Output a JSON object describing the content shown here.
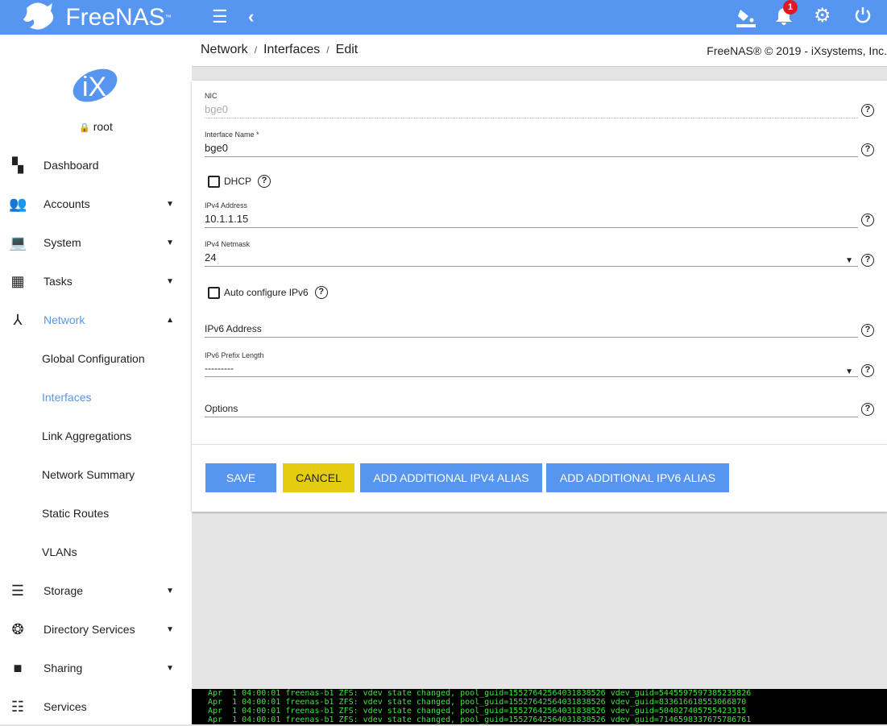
{
  "brand": {
    "name": "FreeNAS",
    "tm": "™"
  },
  "topbar": {
    "notification_count": "1"
  },
  "user": {
    "name": "root"
  },
  "nav": [
    {
      "label": "Dashboard",
      "icon": "dashboard-icon"
    },
    {
      "label": "Accounts",
      "icon": "people-icon"
    },
    {
      "label": "System",
      "icon": "laptop-icon"
    },
    {
      "label": "Tasks",
      "icon": "calendar-icon"
    },
    {
      "label": "Network",
      "icon": "network-icon"
    },
    {
      "label": "Global Configuration"
    },
    {
      "label": "Interfaces"
    },
    {
      "label": "Link Aggregations"
    },
    {
      "label": "Network Summary"
    },
    {
      "label": "Static Routes"
    },
    {
      "label": "VLANs"
    },
    {
      "label": "Storage",
      "icon": "storage-icon"
    },
    {
      "label": "Directory Services",
      "icon": "directory-icon"
    },
    {
      "label": "Sharing",
      "icon": "folder-share-icon"
    },
    {
      "label": "Services",
      "icon": "tune-icon"
    }
  ],
  "breadcrumb": [
    "Network",
    "Interfaces",
    "Edit"
  ],
  "copyright": "FreeNAS® © 2019 - iXsystems, Inc.",
  "form": {
    "nic_label": "NIC",
    "nic_value": "bge0",
    "name_label": "Interface Name *",
    "name_value": "bge0",
    "dhcp_label": "DHCP",
    "ipv4_label": "IPv4 Address",
    "ipv4_value": "10.1.1.15",
    "netmask_label": "IPv4 Netmask",
    "netmask_value": "24",
    "autoconf_label": "Auto configure IPv6",
    "ipv6_placeholder": "IPv6 Address",
    "prefix_label": "IPv6 Prefix Length",
    "prefix_value": "---------",
    "options_placeholder": "Options"
  },
  "buttons": {
    "save": "SAVE",
    "cancel": "CANCEL",
    "add_ipv4": "ADD ADDITIONAL IPV4 ALIAS",
    "add_ipv6": "ADD ADDITIONAL IPV6 ALIAS"
  },
  "colors": {
    "primary": "#5796f0",
    "cancel": "#e4cd0f",
    "badge": "#e01a22",
    "console_text": "#3ee53e"
  },
  "console": [
    "Apr  1 04:00:01 freenas-b1 ZFS: vdev state changed, pool_guid=15527642564031838526 vdev_guid=5445597597385235826",
    "Apr  1 04:00:01 freenas-b1 ZFS: vdev state changed, pool_guid=15527642564031838526 vdev_guid=833616618553066870",
    "Apr  1 04:00:01 freenas-b1 ZFS: vdev state changed, pool_guid=15527642564031838526 vdev_guid=504027405755423315",
    "Apr  1 04:00:01 freenas-b1 ZFS: vdev state changed, pool_guid=15527642564031838526 vdev_guid=7146598337675786761"
  ]
}
